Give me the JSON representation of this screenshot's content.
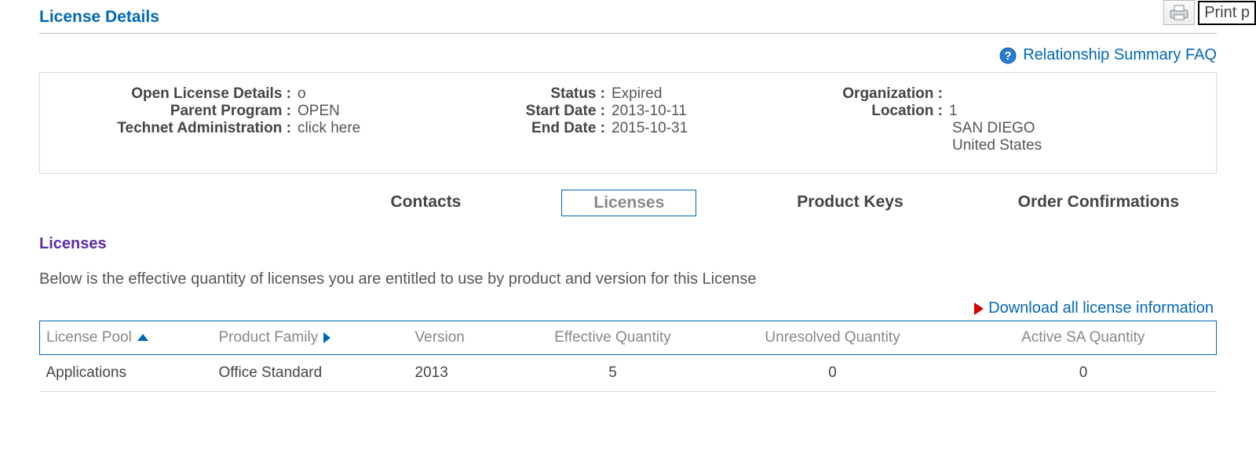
{
  "top": {
    "print_label": "Print p"
  },
  "page_title": "License Details",
  "faq_label": "Relationship Summary FAQ",
  "details": {
    "open_license_label": "Open License Details :",
    "open_license_value": "о",
    "parent_program_label": "Parent Program :",
    "parent_program_value": "OPEN",
    "technet_label": "Technet Administration :",
    "technet_link": "click here",
    "status_label": "Status :",
    "status_value": "Expired",
    "start_date_label": "Start Date :",
    "start_date_value": "2013-10-11",
    "end_date_label": "End Date :",
    "end_date_value": "2015-10-31",
    "organization_label": "Organization :",
    "organization_value": "",
    "location_label": "Location :",
    "location_value": "1",
    "address_city": "SAN DIEGO",
    "address_country": "United States"
  },
  "tabs": {
    "contacts": "Contacts",
    "licenses": "Licenses",
    "product_keys": "Product Keys",
    "order_confirmations": "Order Confirmations"
  },
  "section": {
    "title": "Licenses",
    "description": "Below is the effective quantity of licenses you are entitled to use by product and version for this License",
    "download_link": "Download all license information"
  },
  "table": {
    "headers": {
      "license_pool": "License Pool",
      "product_family": "Product Family",
      "version": "Version",
      "effective_qty": "Effective Quantity",
      "unresolved_qty": "Unresolved Quantity",
      "active_sa_qty": "Active SA Quantity"
    },
    "rows": [
      {
        "license_pool": "Applications",
        "product_family": "Office Standard",
        "version": "2013",
        "effective_qty": "5",
        "unresolved_qty": "0",
        "active_sa_qty": "0"
      }
    ]
  }
}
